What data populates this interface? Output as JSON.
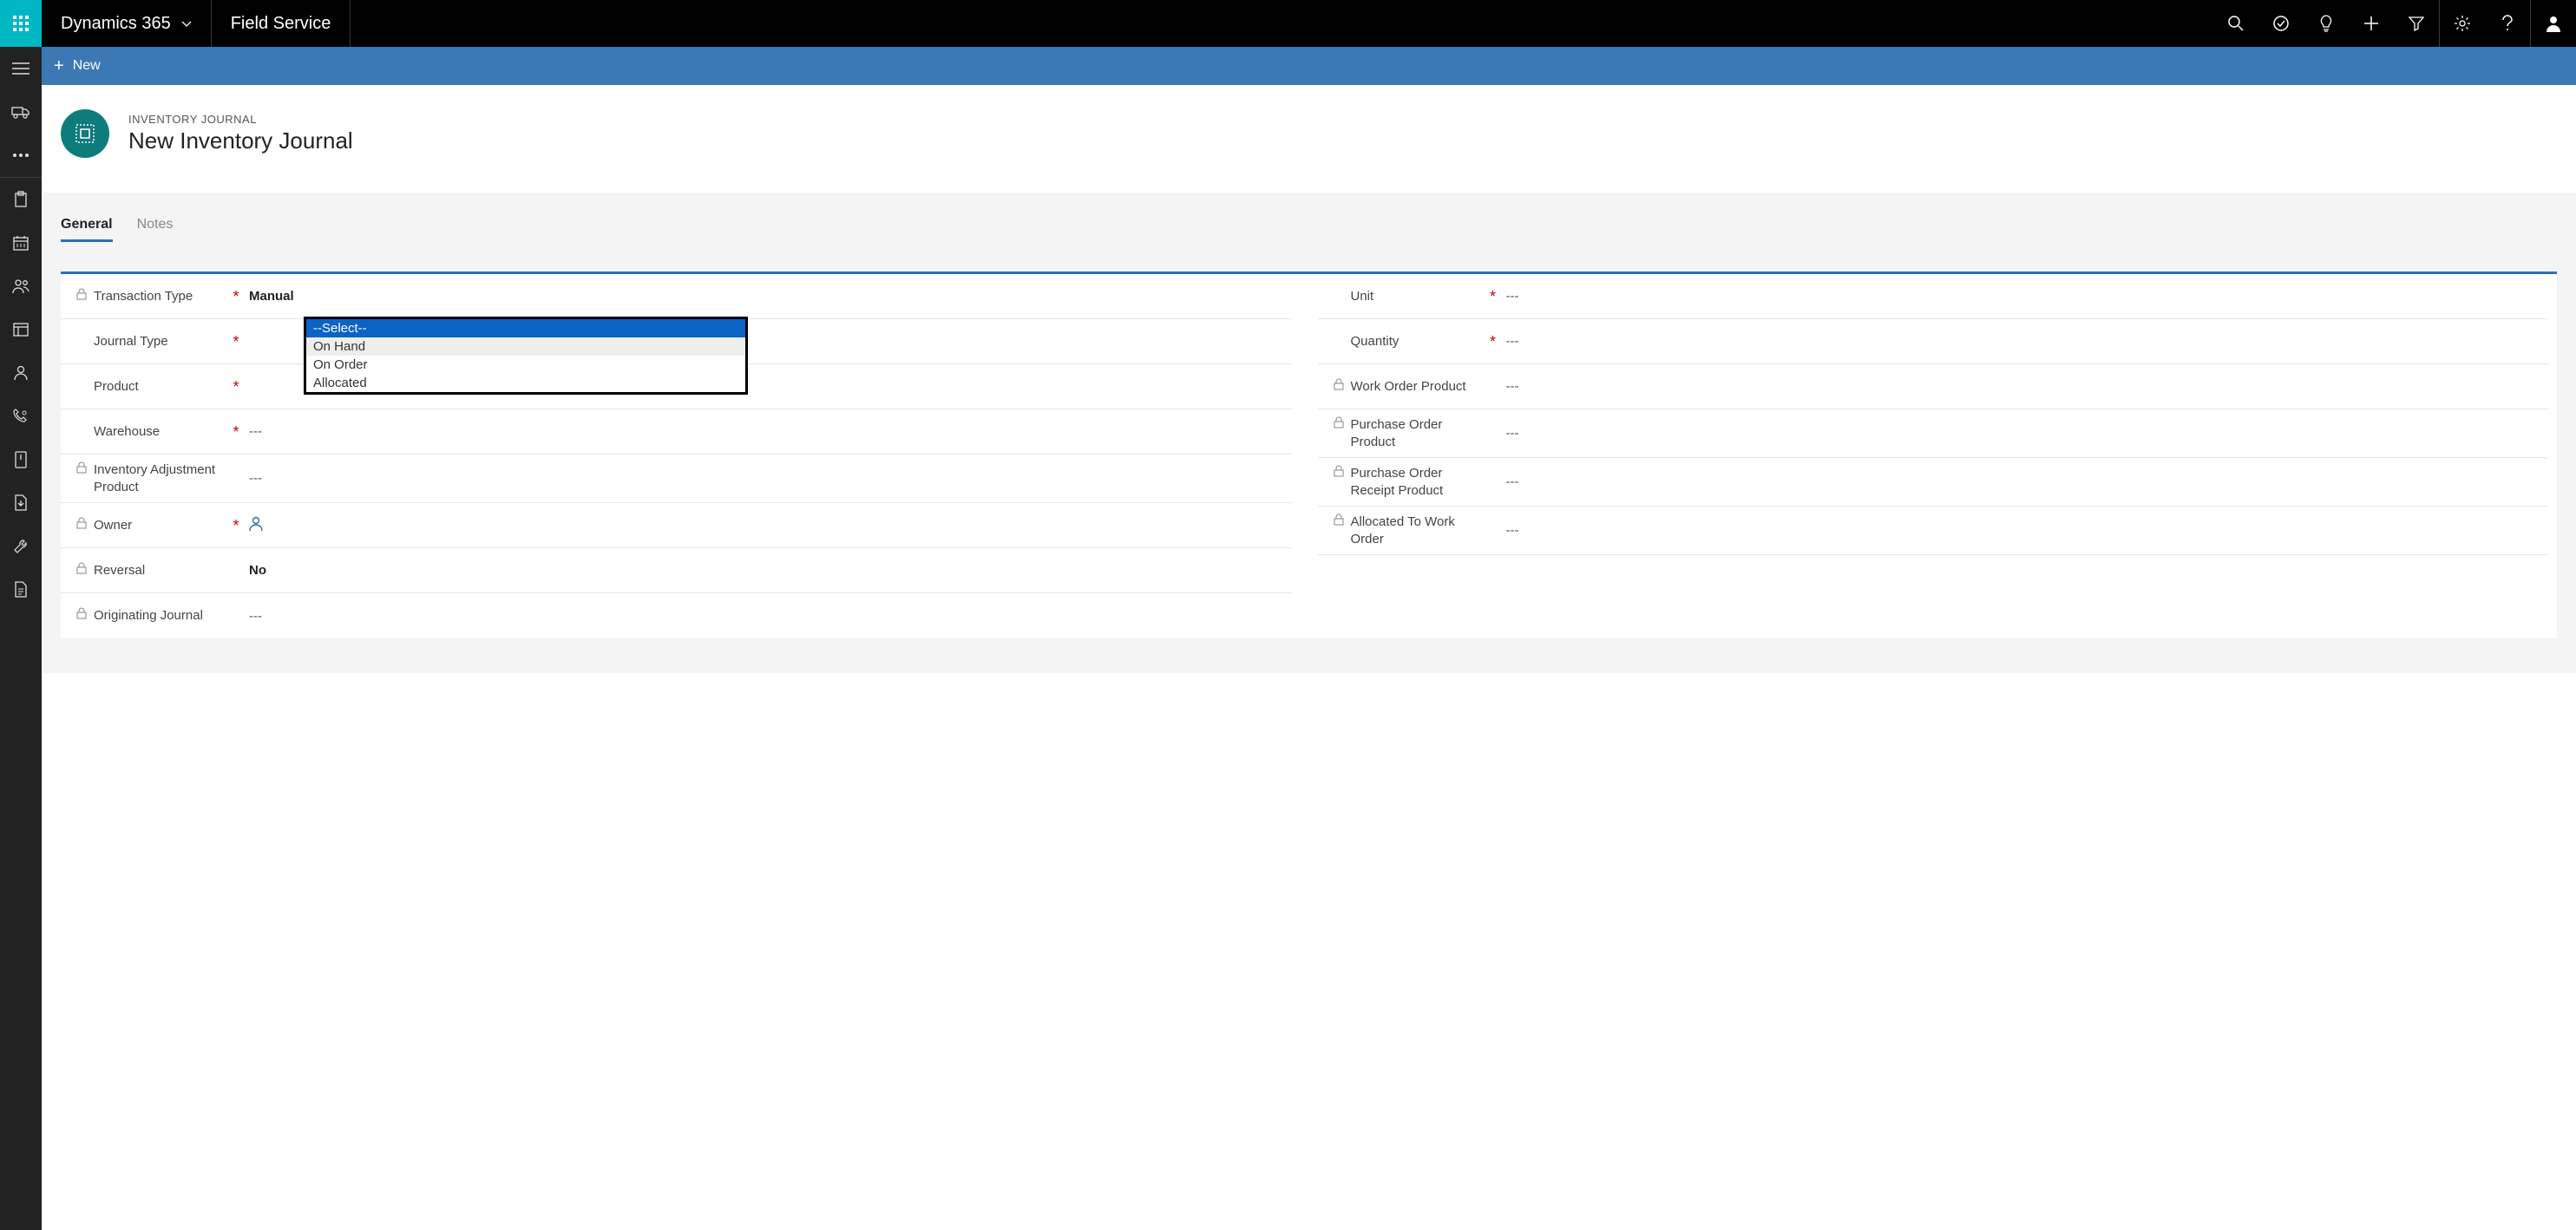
{
  "topbar": {
    "brand": "Dynamics 365",
    "module": "Field Service"
  },
  "cmdbar": {
    "new_label": "New"
  },
  "record": {
    "eyebrow": "INVENTORY JOURNAL",
    "title": "New Inventory Journal"
  },
  "tabs": {
    "general": "General",
    "notes": "Notes"
  },
  "fields": {
    "transaction_type": {
      "label": "Transaction Type",
      "value": "Manual"
    },
    "journal_type": {
      "label": "Journal Type"
    },
    "product": {
      "label": "Product"
    },
    "warehouse": {
      "label": "Warehouse",
      "value": "---"
    },
    "iap": {
      "label": "Inventory Adjustment Product",
      "value": "---"
    },
    "owner": {
      "label": "Owner"
    },
    "reversal": {
      "label": "Reversal",
      "value": "No"
    },
    "orig_journal": {
      "label": "Originating Journal",
      "value": "---"
    },
    "unit": {
      "label": "Unit",
      "value": "---"
    },
    "quantity": {
      "label": "Quantity",
      "value": "---"
    },
    "wop": {
      "label": "Work Order Product",
      "value": "---"
    },
    "pop": {
      "label": "Purchase Order Product",
      "value": "---"
    },
    "porp": {
      "label": "Purchase Order Receipt Product",
      "value": "---"
    },
    "atwo": {
      "label": "Allocated To Work Order",
      "value": "---"
    }
  },
  "dropdown": {
    "options": [
      "--Select--",
      "On Hand",
      "On Order",
      "Allocated"
    ]
  }
}
